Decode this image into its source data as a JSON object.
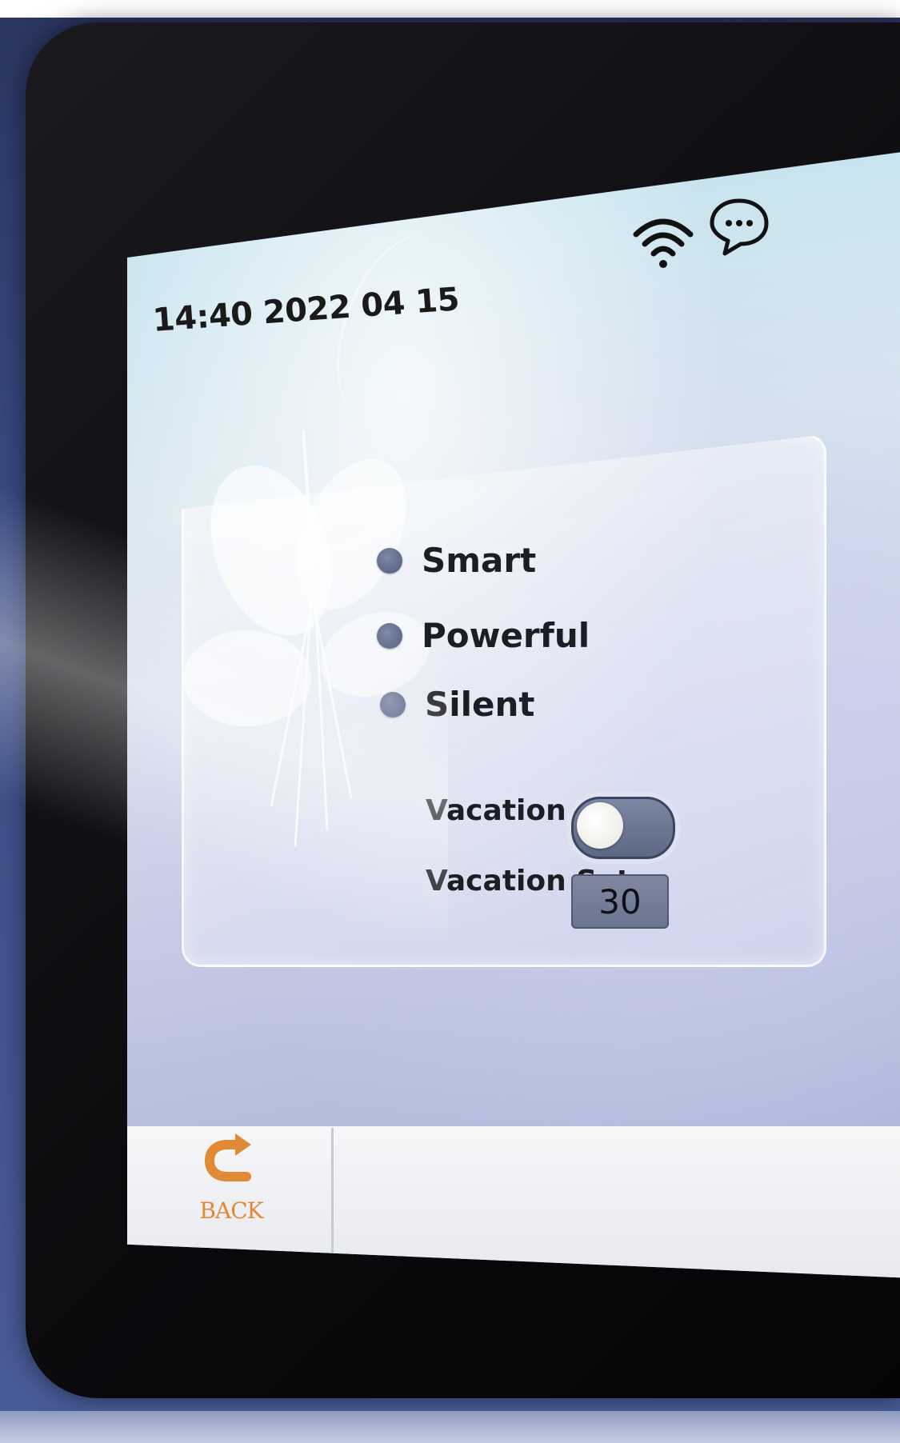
{
  "status_bar": {
    "datetime": "14:40 2022 04 15",
    "wifi_icon": "wifi-icon",
    "message_icon": "chat-bubble-icon"
  },
  "modes": [
    {
      "label": "Smart"
    },
    {
      "label": "Powerful"
    },
    {
      "label": "Silent"
    }
  ],
  "vacation": {
    "label": "Vacation",
    "enabled": false,
    "set_label": "Vacation Set",
    "set_value": "30"
  },
  "footer": {
    "back_label": "BACK",
    "back_icon": "back-arrow-icon"
  },
  "colors": {
    "accent_orange": "#e08a35",
    "radio_fill": "#5d6884",
    "toggle_track": "#6b7490"
  }
}
